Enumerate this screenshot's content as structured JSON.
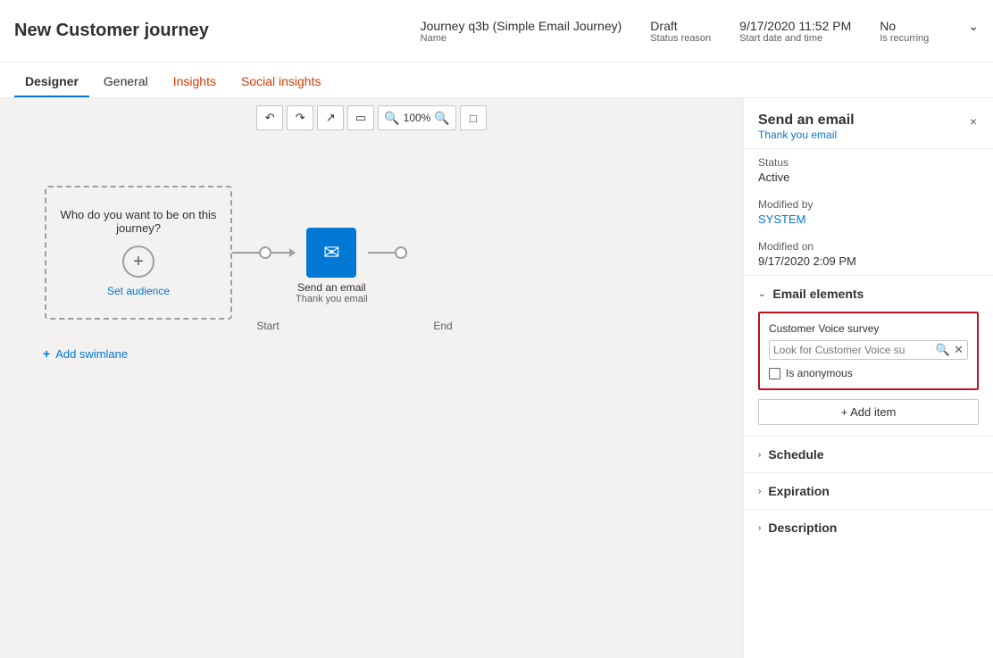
{
  "header": {
    "title": "New Customer journey",
    "meta": {
      "name_value": "Journey q3b (Simple Email Journey)",
      "name_label": "Name",
      "status_value": "Draft",
      "status_label": "Status reason",
      "date_value": "9/17/2020 11:52 PM",
      "date_label": "Start date and time",
      "recurring_value": "No",
      "recurring_label": "Is recurring"
    }
  },
  "tabs": [
    {
      "id": "designer",
      "label": "Designer",
      "active": true
    },
    {
      "id": "general",
      "label": "General",
      "active": false
    },
    {
      "id": "insights",
      "label": "Insights",
      "active": false
    },
    {
      "id": "social-insights",
      "label": "Social insights",
      "active": false
    }
  ],
  "toolbar": {
    "undo": "↩",
    "redo": "↪",
    "expand": "↗",
    "split": "⊟",
    "zoom_out": "−",
    "zoom_level": "100%",
    "zoom_in": "+",
    "fit": "⊡"
  },
  "canvas": {
    "audience_text": "Who do you want to be on this journey?",
    "set_audience_label": "Set audience",
    "start_label": "Start",
    "end_label": "End",
    "email_node_title": "Send an email",
    "email_node_subtitle": "Thank you email",
    "add_swimlane_label": "Add swimlane"
  },
  "right_panel": {
    "title": "Send an email",
    "subtitle": "Thank you email",
    "close_icon": "×",
    "status_label": "Status",
    "status_value": "Active",
    "modified_by_label": "Modified by",
    "modified_by_value": "SYSTEM",
    "modified_on_label": "Modified on",
    "modified_on_value": "9/17/2020 2:09 PM",
    "email_elements_label": "Email elements",
    "cv_survey_label": "Customer Voice survey",
    "cv_search_placeholder": "Look for Customer Voice su",
    "cv_anonymous_label": "Is anonymous",
    "add_item_label": "+ Add item",
    "schedule_label": "Schedule",
    "expiration_label": "Expiration",
    "description_label": "Description"
  }
}
